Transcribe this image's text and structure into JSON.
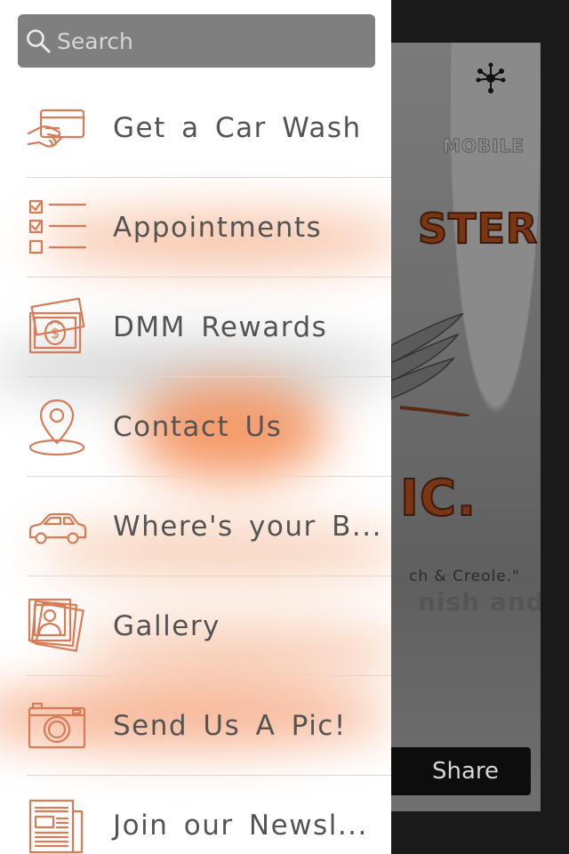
{
  "search": {
    "placeholder": "Search"
  },
  "menu": [
    {
      "label": "Get a Car Wash",
      "icon": "card-hand-icon"
    },
    {
      "label": "Appointments",
      "icon": "checklist-icon"
    },
    {
      "label": "DMM Rewards",
      "icon": "money-icon"
    },
    {
      "label": "Contact Us",
      "icon": "map-pin-icon"
    },
    {
      "label": "Where's your B...",
      "icon": "car-icon"
    },
    {
      "label": "Gallery",
      "icon": "photo-stack-icon"
    },
    {
      "label": "Send Us A Pic!",
      "icon": "camera-icon"
    },
    {
      "label": "Join our Newsl...",
      "icon": "newspaper-icon"
    }
  ],
  "background_app": {
    "flyer_text_1": "STER",
    "flyer_text_2": "IC.",
    "flyer_text_3": "ch & Creole.\"",
    "flyer_text_4": "nish and Cr",
    "flyer_badge": "MOBILE",
    "share_label": "Share"
  },
  "colors": {
    "accent": "#d97b56",
    "search_bg": "#7f7f7f",
    "label_text": "#545454",
    "divider": "#e9d4cb"
  }
}
